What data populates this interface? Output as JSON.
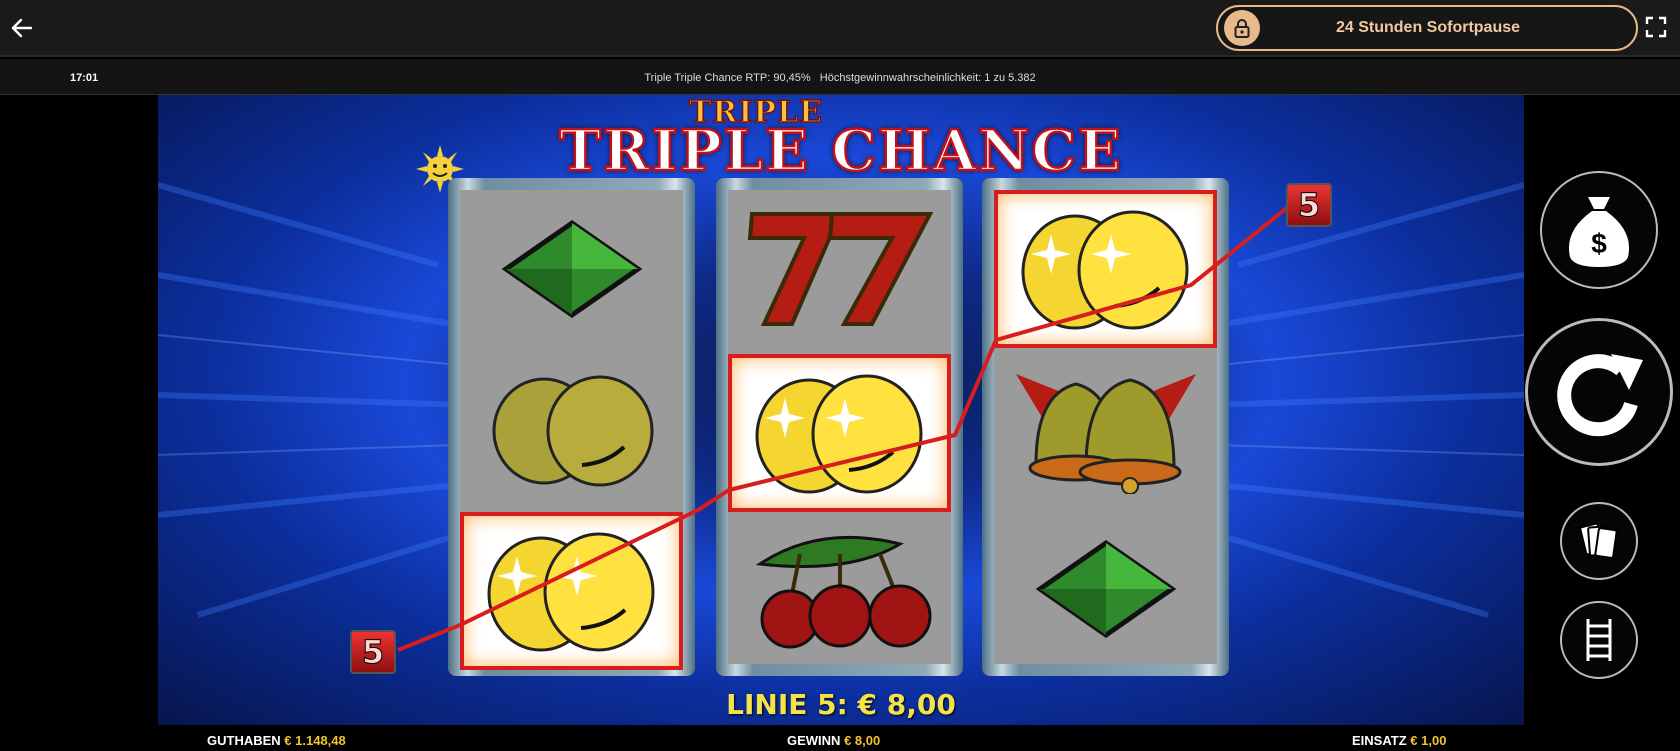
{
  "topbar": {
    "back_icon": "arrow-left-icon",
    "pause_label": "24 Stunden Sofortpause",
    "pause_icon": "lock-icon",
    "fullscreen_icon": "fullscreen-icon",
    "accent": "#e8b98a"
  },
  "infobar": {
    "time": "17:01",
    "rtp_text": "Triple Triple Chance RTP: 90,45%   Höchstgewinnwahrscheinlichkeit: 1 zu 5.382"
  },
  "game": {
    "title_small": "TRIPLE",
    "title_big": "TRIPLE CHANCE",
    "reels": [
      [
        "diamond",
        "lemon",
        "lemon"
      ],
      [
        "seven",
        "lemon",
        "cherry"
      ],
      [
        "lemon",
        "bell",
        "diamond"
      ]
    ],
    "winning_cells": [
      [
        0,
        2
      ],
      [
        1,
        1
      ],
      [
        2,
        0
      ]
    ],
    "line_number_left": "5",
    "line_number_right": "5",
    "win_text": "LINIE 5: € 8,00"
  },
  "side_buttons": {
    "money_icon": "money-bag-icon",
    "spin_icon": "spin-arrow-icon",
    "cards_icon": "cards-icon",
    "ladder_icon": "ladder-icon"
  },
  "bottombar": {
    "balance_label": "GUTHABEN",
    "balance_value": "€ 1.148,48",
    "win_label": "GEWINN",
    "win_value": "€ 8,00",
    "bet_label": "EINSATZ",
    "bet_value": "€ 1,00"
  }
}
